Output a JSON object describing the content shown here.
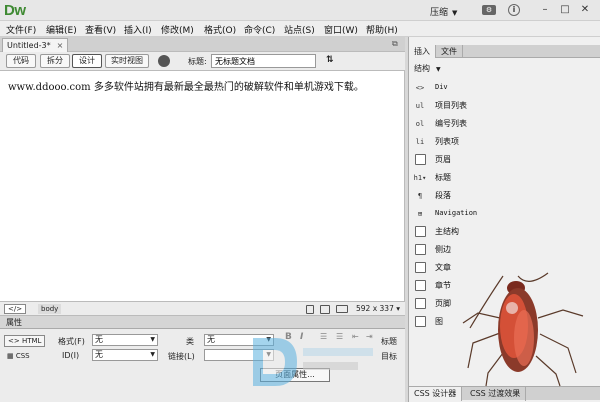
{
  "app": {
    "logo": "Dw",
    "workspace": "压缩"
  },
  "menu": [
    "文件(F)",
    "编辑(E)",
    "查看(V)",
    "插入(I)",
    "修改(M)",
    "格式(O)",
    "命令(C)",
    "站点(S)",
    "窗口(W)",
    "帮助(H)"
  ],
  "document": {
    "tab_name": "Untitled-3*",
    "title_label": "标题:",
    "title_value": "无标题文档",
    "content": "www.ddooo.com 多多软件站拥有最新最全最热门的破解软件和单机游戏下载。"
  },
  "view_buttons": [
    "代码",
    "拆分",
    "设计",
    "实时视图"
  ],
  "status": {
    "tag_body": "body",
    "dimensions": "592 x 337"
  },
  "properties": {
    "title": "属性",
    "html_btn": "HTML",
    "css_btn": "CSS",
    "format_label": "格式(F)",
    "format_value": "无",
    "class_label": "类",
    "class_value": "无",
    "id_label": "ID(I)",
    "id_value": "无",
    "link_label": "链接(L)",
    "page_props": "页面属性...",
    "title_right": "标题",
    "target_right": "目标"
  },
  "insert_panel": {
    "tabs": [
      "插入",
      "文件"
    ],
    "category": "结构",
    "items": [
      {
        "icon": "<>",
        "label": "Div"
      },
      {
        "icon": "ul",
        "label": "项目列表"
      },
      {
        "icon": "ol",
        "label": "编号列表"
      },
      {
        "icon": "li",
        "label": "列表项"
      },
      {
        "icon": "header-icon",
        "label": "页眉"
      },
      {
        "icon": "heading-icon",
        "label": "标题"
      },
      {
        "icon": "paragraph-icon",
        "label": "段落"
      },
      {
        "icon": "nav-icon",
        "label": "Navigation"
      },
      {
        "icon": "main-icon",
        "label": "主结构"
      },
      {
        "icon": "aside-icon",
        "label": "侧边"
      },
      {
        "icon": "article-icon",
        "label": "文章"
      },
      {
        "icon": "section-icon",
        "label": "章节"
      },
      {
        "icon": "footer-icon",
        "label": "页脚"
      },
      {
        "icon": "figure-icon",
        "label": "图"
      }
    ]
  },
  "bottom_tabs": [
    "CSS 设计器",
    "CSS 过渡效果"
  ]
}
